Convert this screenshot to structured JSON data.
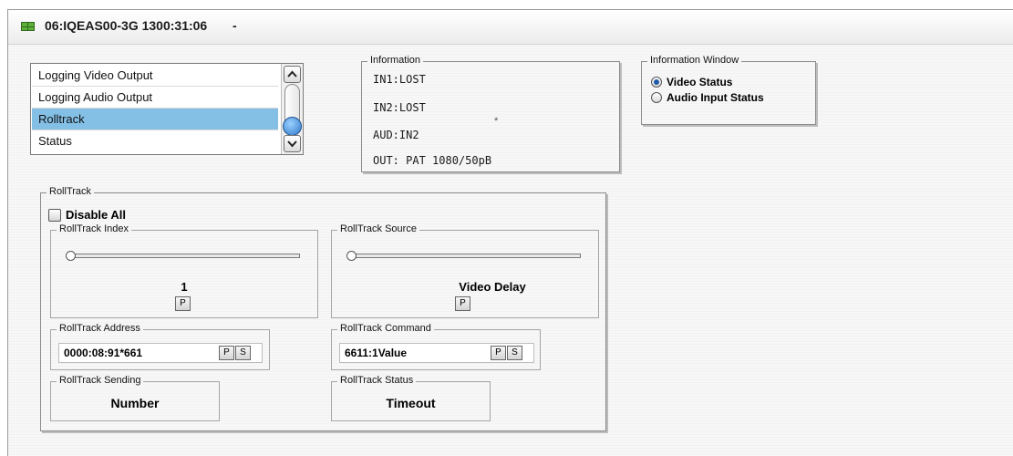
{
  "window": {
    "title": "06:IQEAS00-3G  1300:31:06",
    "title_suffix": "-"
  },
  "list": {
    "items": [
      "Logging Video Output",
      "Logging Audio Output",
      "Rolltrack",
      "Status"
    ],
    "selected": "Rolltrack"
  },
  "information": {
    "label": "Information",
    "lines": [
      "IN1:LOST",
      "IN2:LOST",
      "AUD:IN2",
      "OUT: PAT 1080/50pB"
    ],
    "marker": "*"
  },
  "information_window": {
    "label": "Information Window",
    "options": [
      "Video Status",
      "Audio Input Status"
    ],
    "selected": "Video Status"
  },
  "rolltrack": {
    "label": "RollTrack",
    "disable_all": "Disable All",
    "index": {
      "label": "RollTrack Index",
      "value": "1",
      "p": "P",
      "slider_level": 0
    },
    "source": {
      "label": "RollTrack Source",
      "value": "Video Delay",
      "p": "P",
      "slider_level": 0
    },
    "address": {
      "label": "RollTrack Address",
      "value": "0000:08:91*661",
      "p": "P",
      "s": "S"
    },
    "command": {
      "label": "RollTrack Command",
      "value": "6611:1Value",
      "p": "P",
      "s": "S"
    },
    "sending": {
      "label": "RollTrack Sending",
      "value": "Number"
    },
    "status": {
      "label": "RollTrack Status",
      "value": "Timeout"
    }
  }
}
